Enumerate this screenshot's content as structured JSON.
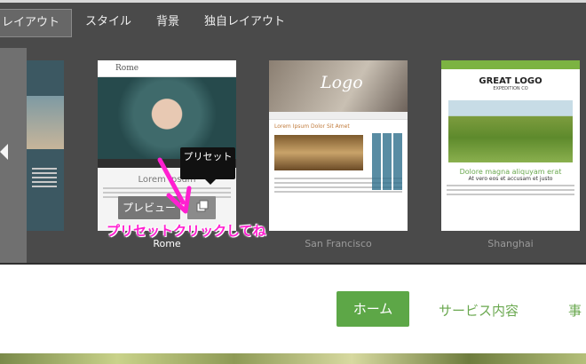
{
  "tabs": [
    {
      "label": "レイアウト",
      "active": true
    },
    {
      "label": "スタイル",
      "active": false
    },
    {
      "label": "背景",
      "active": false
    },
    {
      "label": "独自レイアウト",
      "active": false
    }
  ],
  "templates": [
    {
      "name": "Rome",
      "header_text": "Rome",
      "body_title": "Lorem Ipsum"
    },
    {
      "name": "San Francisco",
      "logo_text": "Logo",
      "body_title": "Lorem Ipsum Dolor Sit Amet"
    },
    {
      "name": "Shanghai",
      "logo_text": "GREAT LOGO",
      "logo_sub": "EXPEDITION CO",
      "body_title": "Dolore magna aliquyam erat",
      "body_sub": "At vero eos et accusam et justo"
    }
  ],
  "overlay": {
    "preview_label": "プレビュー",
    "tooltip_text": "プリセット",
    "annotation": "プリセットクリックしてね"
  },
  "site_nav": {
    "home": "ホーム",
    "services": "サービス内容",
    "partial": "事"
  },
  "colors": {
    "editor_bg": "#4a4a4a",
    "accent_green": "#5da747",
    "annotation_pink": "#ff1fd0"
  }
}
